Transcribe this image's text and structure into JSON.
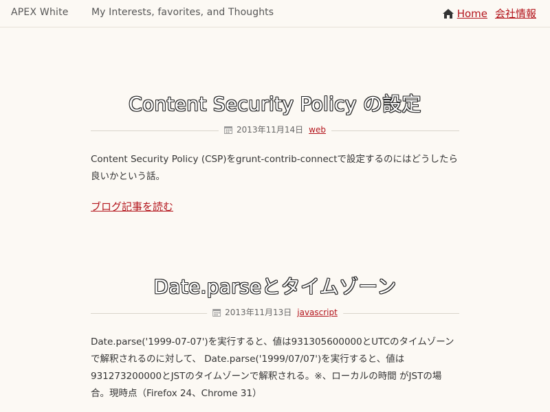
{
  "header": {
    "brand": "APEX White",
    "tagline": "My Interests, favorites, and Thoughts",
    "nav": {
      "home_label": "Home",
      "company_label": "会社情報"
    }
  },
  "posts": [
    {
      "title": "Content Security Policy の設定",
      "date": "2013年11月14日",
      "category": "web",
      "excerpt": "Content Security Policy (CSP)をgrunt-contrib-connectで設定するのにはどうしたら良いかという話。",
      "read_more": "ブログ記事を読む"
    },
    {
      "title": "Date.parseとタイムゾーン",
      "date": "2013年11月13日",
      "category": "javascript",
      "excerpt": "Date.parse('1999-07-07')を実行すると、値は931305600000とUTCのタイムゾーンで解釈されるのに対して、 Date.parse('1999/07/07')を実行すると、値は931273200000とJSTのタイムゾーンで解釈される。※、ローカルの時間 がJSTの場合。現時点（Firefox 24、Chrome 31）"
    }
  ],
  "colors": {
    "background": "#fcf9f4",
    "link": "#b3141b",
    "text": "#333333"
  },
  "icons": [
    "home-icon",
    "calendar-icon"
  ]
}
